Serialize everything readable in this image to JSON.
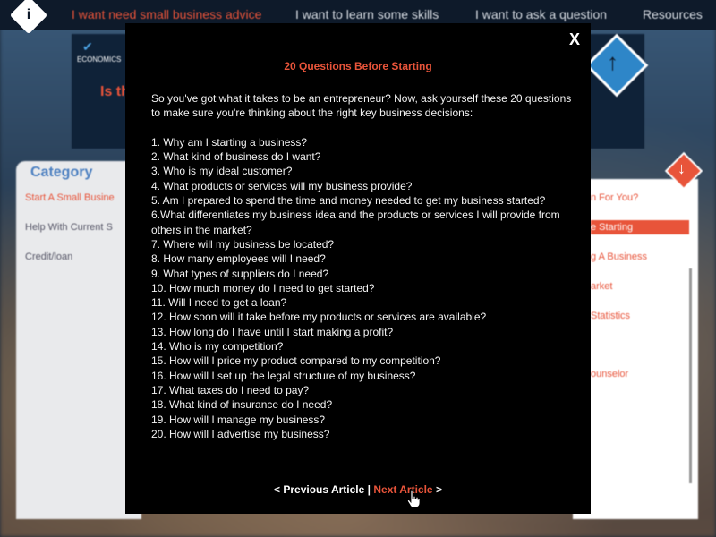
{
  "nav": {
    "items": [
      "I want need small business advice",
      "I want to learn some skills",
      "I want to ask a question",
      "Resources"
    ]
  },
  "background": {
    "banner_text": "Is th",
    "econ_logo": "ECONOMICS",
    "category_title": "Category",
    "left_items": [
      "Start A Small Busine",
      "Help With Current S",
      "Credit/loan"
    ],
    "right_items": [
      "n For You?",
      "e Starting",
      "g A Business",
      "arket",
      "Statistics",
      "ounselor"
    ]
  },
  "modal": {
    "close_label": "X",
    "title": "20 Questions Before Starting",
    "intro": "So you've got what it takes to be an entrepreneur? Now, ask yourself these 20 questions to make sure you're thinking about the right key business decisions:",
    "questions": [
      "1. Why am I starting a business?",
      "2. What kind of business do I want?",
      "3. Who is my ideal customer?",
      "4. What products or services will my business provide?",
      "5. Am I prepared to spend the time and money needed to get my business started?",
      "6.What differentiates my business idea and the products or services I will provide from others in the market?",
      "7. Where will my business be located?",
      "8. How many employees will I need?",
      "9. What types of suppliers do I need?",
      "10.  How much money do I need to get started?",
      "11. Will I need to get a loan?",
      "12. How soon will it take before my products or services are available?",
      "13. How long do I have until I start making a profit?",
      "14. Who is my competition?",
      "15. How will I price my product compared to my competition?",
      "16. How will I set up the legal structure of my business?",
      "17. What taxes do I need to pay?",
      "18. What kind of insurance do I need?",
      "19. How will I manage my business?",
      "20. How will I advertise my business?"
    ],
    "footer": {
      "prev_label": "< Previous Article",
      "separator": "|",
      "next_label": "Next Article",
      "next_arrow": ">"
    }
  },
  "colors": {
    "accent": "#e8543a",
    "modal_bg": "#000000",
    "nav_bg": "#0e1a2a"
  }
}
